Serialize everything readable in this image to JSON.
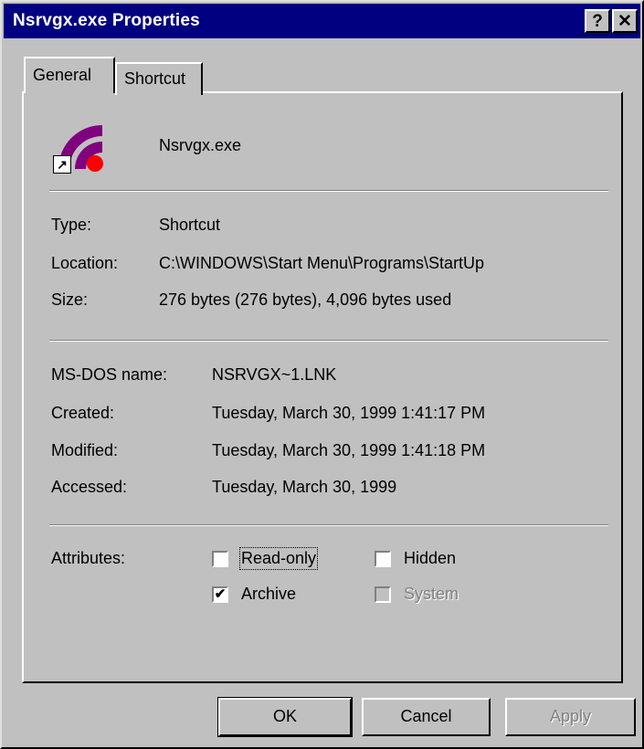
{
  "window": {
    "title": "Nsrvgx.exe Properties",
    "help_label": "?",
    "close_label": "✕"
  },
  "tabs": [
    {
      "label": "General",
      "active": true
    },
    {
      "label": "Shortcut",
      "active": false
    }
  ],
  "file": {
    "name": "Nsrvgx.exe",
    "icon": "shortcut-app-icon"
  },
  "info": {
    "type_label": "Type:",
    "type_value": "Shortcut",
    "location_label": "Location:",
    "location_value": "C:\\WINDOWS\\Start Menu\\Programs\\StartUp",
    "size_label": "Size:",
    "size_value": "276 bytes (276 bytes), 4,096 bytes used"
  },
  "dates": {
    "msdos_label": "MS-DOS name:",
    "msdos_value": "NSRVGX~1.LNK",
    "created_label": "Created:",
    "created_value": "Tuesday, March 30, 1999 1:41:17 PM",
    "modified_label": "Modified:",
    "modified_value": "Tuesday, March 30, 1999 1:41:18 PM",
    "accessed_label": "Accessed:",
    "accessed_value": "Tuesday, March 30, 1999"
  },
  "attributes": {
    "label": "Attributes:",
    "readonly": {
      "label": "Read-only",
      "checked": false
    },
    "hidden": {
      "label": "Hidden",
      "checked": false
    },
    "archive": {
      "label": "Archive",
      "checked": true
    },
    "system": {
      "label": "System",
      "checked": false,
      "disabled": true
    }
  },
  "buttons": {
    "ok": "OK",
    "cancel": "Cancel",
    "apply": "Apply"
  },
  "colors": {
    "titlebar": "#000080",
    "face": "#c0c0c0",
    "icon_purple": "#800080",
    "icon_red": "#ff0000"
  }
}
